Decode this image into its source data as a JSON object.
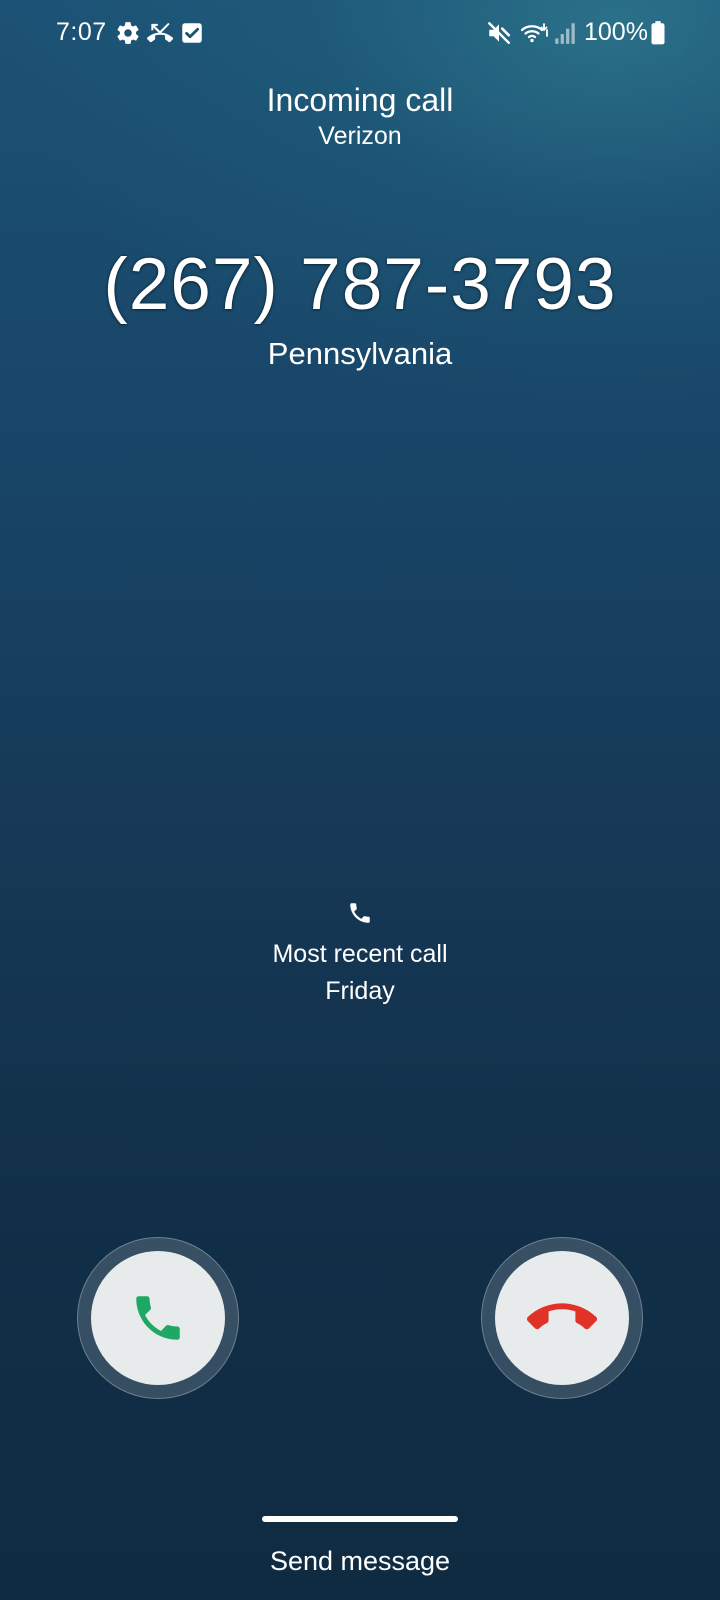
{
  "status_bar": {
    "time": "7:07",
    "battery_percent": "100%",
    "left_icons": [
      "settings-gear-icon",
      "missed-call-icon",
      "checkbox-icon"
    ],
    "right_icons": [
      "mute-icon",
      "wifi-calling-icon",
      "signal-icon",
      "battery-icon"
    ]
  },
  "call": {
    "title": "Incoming call",
    "carrier": "Verizon",
    "number": "(267) 787-3793",
    "location": "Pennsylvania"
  },
  "recent": {
    "icon": "phone-icon",
    "label": "Most recent call",
    "day": "Friday"
  },
  "actions": {
    "accept_icon": "phone-accept-icon",
    "decline_icon": "phone-decline-icon",
    "accept_color": "#1fa863",
    "decline_color": "#e03227",
    "send_message": "Send message"
  },
  "colors": {
    "background_top": "#1c5275",
    "background_bottom": "#0f2b42",
    "button_fill": "#e7ebec"
  }
}
